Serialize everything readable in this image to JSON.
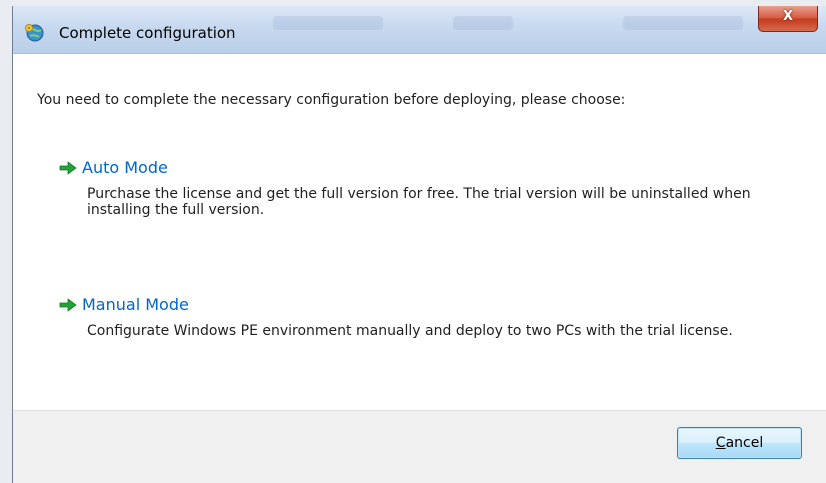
{
  "window": {
    "title": "Complete configuration",
    "close_label": "X"
  },
  "content": {
    "intro": "You need to complete the necessary configuration before deploying, please choose:",
    "options": [
      {
        "label": "Auto Mode",
        "description": "Purchase the license and get the full version for free. The trial version will be uninstalled when installing the full version."
      },
      {
        "label": "Manual Mode",
        "description": "Configurate Windows PE environment manually and deploy to two PCs with the trial license."
      }
    ]
  },
  "footer": {
    "cancel_accel": "C",
    "cancel_rest": "ancel"
  },
  "icons": {
    "app": "gear-globe-icon",
    "option_arrow": "green-arrow-right-icon"
  },
  "colors": {
    "link": "#0066cc",
    "arrow": "#22a33a",
    "close_button": "#c9452a"
  }
}
